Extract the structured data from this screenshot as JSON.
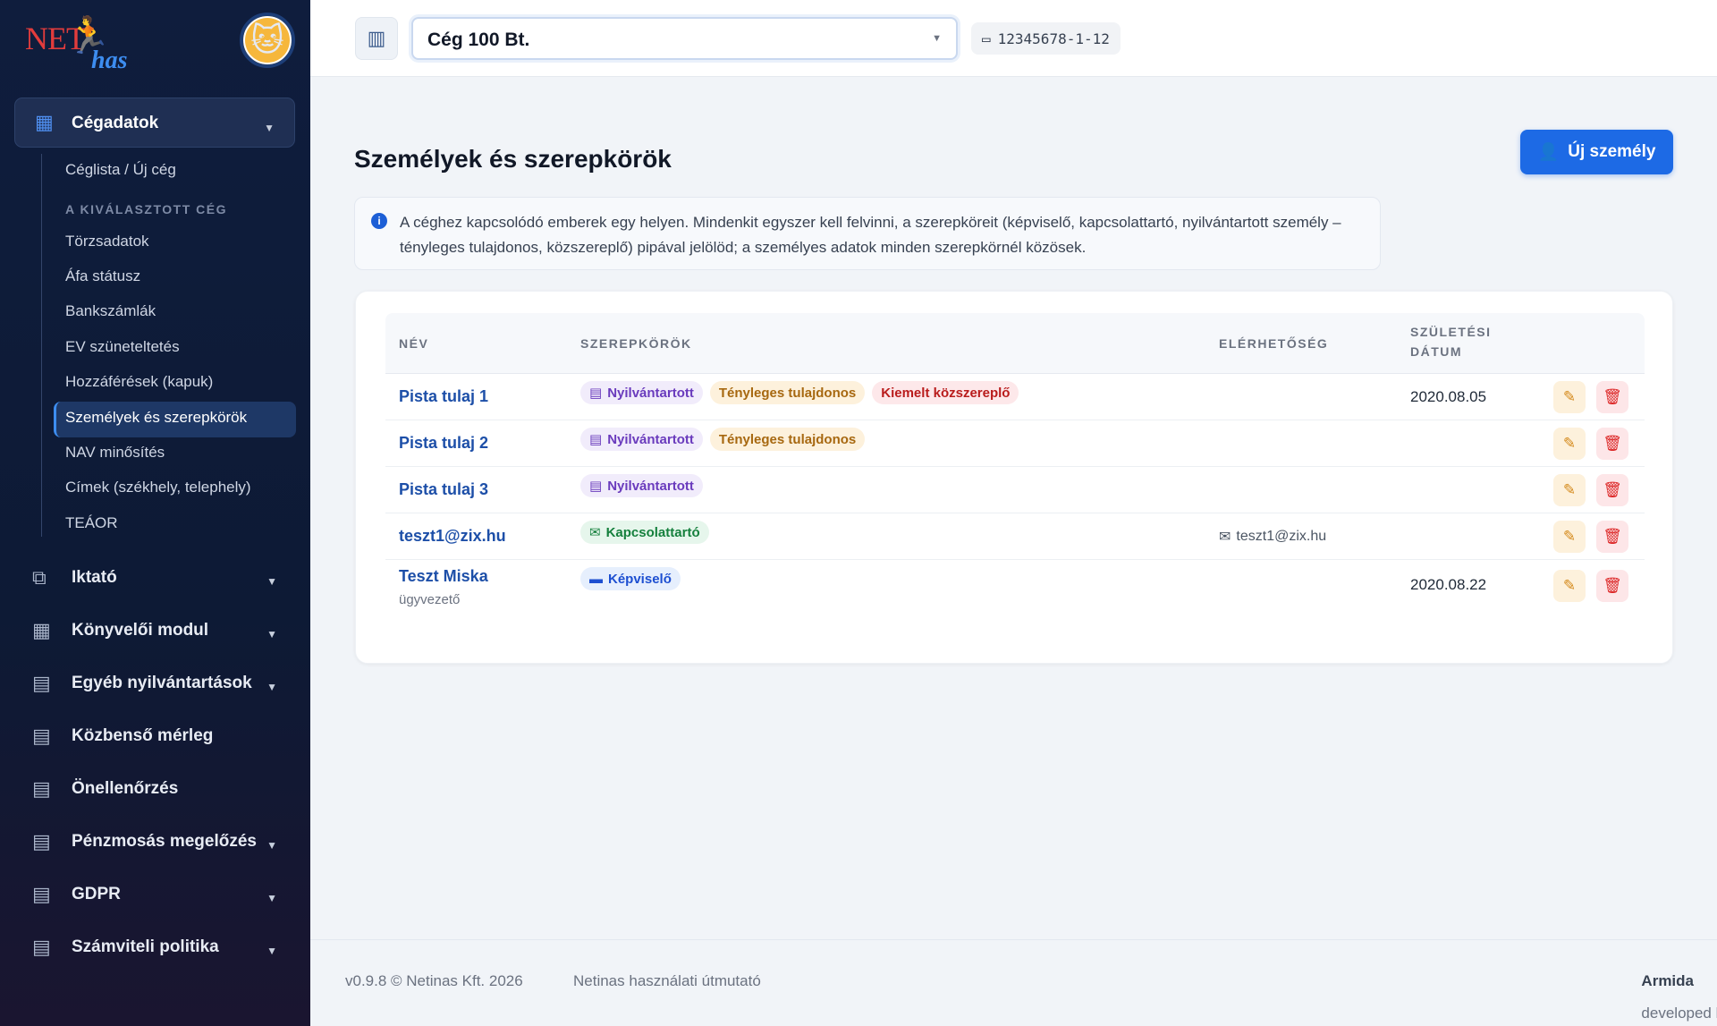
{
  "brand": {
    "logo_text_1": "NET",
    "logo_text_2": "has",
    "avatar_emoji": "🐱"
  },
  "sidebar": {
    "top": {
      "label": "Cégadatok",
      "icon": "building-icon"
    },
    "sub_first": "Céglista / Új cég",
    "section_head": "A KIVÁLASZTOTT CÉG",
    "sub_items": [
      "Törzsadatok",
      "Áfa státusz",
      "Bankszámlák",
      "EV szüneteltetés",
      "Hozzáférések (kapuk)",
      "Személyek és szerepkörök",
      "NAV minősítés",
      "Címek (székhely, telephely)",
      "TEÁOR"
    ],
    "items": [
      {
        "label": "Iktató",
        "icon": "copy-icon"
      },
      {
        "label": "Könyvelői modul",
        "icon": "calculator-icon"
      },
      {
        "label": "Egyéb nyilvántartások",
        "icon": "calendar-icon"
      },
      {
        "label": "Közbenső mérleg",
        "icon": "calendar-icon"
      },
      {
        "label": "Önellenőrzés",
        "icon": "calendar-icon"
      },
      {
        "label": "Pénzmosás megelőzés",
        "icon": "calendar-icon"
      },
      {
        "label": "GDPR",
        "icon": "calendar-icon"
      },
      {
        "label": "Számviteli politika",
        "icon": "calendar-icon"
      }
    ]
  },
  "topbar": {
    "company": "Cég 100 Bt.",
    "tax_id": "12345678-1-12"
  },
  "main": {
    "title": "Személyek és szerepkörök",
    "new_button": "Új személy",
    "info": "A céghez kapcsolódó emberek egy helyen. Mindenkit egyszer kell felvinni, a szerepköreit (képviselő, kapcsolattartó, nyilvántartott személy – tényleges tulajdonos, közszereplő) pipával jelölöd; a személyes adatok minden szerepkörnél közösek.",
    "columns": {
      "name": "NÉV",
      "roles": "SZEREPKÖRÖK",
      "contact": "ELÉRHETŐSÉG",
      "birth_1": "SZÜLETÉSI",
      "birth_2": "DÁTUM"
    },
    "rows": [
      {
        "name": "Pista tulaj 1",
        "roles": [
          "Nyilvántartott",
          "Tényleges tulajdonos",
          "Kiemelt közszereplő"
        ],
        "contact": "",
        "date": "2020.08.05"
      },
      {
        "name": "Pista tulaj 2",
        "roles": [
          "Nyilvántartott",
          "Tényleges tulajdonos"
        ],
        "contact": "",
        "date": ""
      },
      {
        "name": "Pista tulaj 3",
        "roles": [
          "Nyilvántartott"
        ],
        "contact": "",
        "date": ""
      },
      {
        "name": "teszt1@zix.hu",
        "roles": [
          "Kapcsolattartó"
        ],
        "contact": "teszt1@zix.hu",
        "date": ""
      },
      {
        "name": "Teszt Miska",
        "sub": "ügyvezető",
        "roles": [
          "Képviselő"
        ],
        "contact": "",
        "date": "2020.08.22"
      }
    ]
  },
  "footer": {
    "version": "v0.9.8 © Netinas Kft. 2026",
    "guide": "Netinas használati útmutató",
    "dev_prefix": "developed by",
    "dev_name": "Armida"
  },
  "colors": {
    "accent": "#1d6ae5",
    "sidebar_bg": "#0f1d3d"
  }
}
